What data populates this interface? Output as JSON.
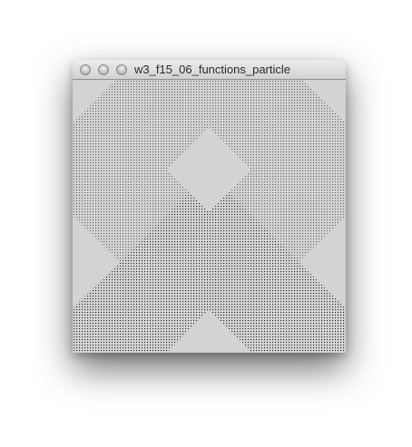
{
  "window": {
    "title": "w3_f15_06_functions_particle",
    "buttons": {
      "close": "close-button",
      "minimize": "minimize-button",
      "zoom": "zoom-button"
    }
  },
  "canvas": {
    "background_color": "#d3d3d3",
    "dot_color": "#1a1a1a",
    "description_icon": "particle-pattern"
  }
}
